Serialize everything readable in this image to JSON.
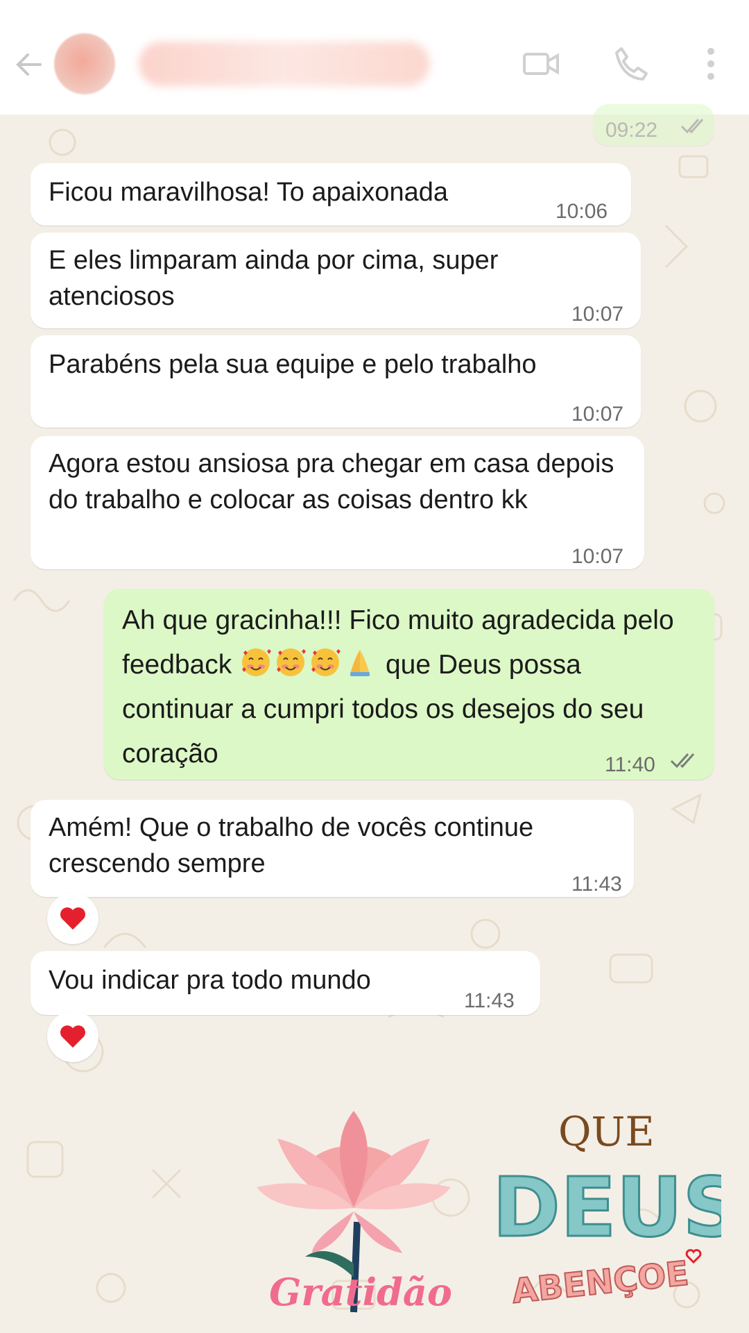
{
  "messages": [
    {
      "text": "",
      "time": "09:22",
      "direction": "out"
    },
    {
      "text": "Ficou maravilhosa! To apaixonada",
      "time": "10:06",
      "direction": "in"
    },
    {
      "text": "E eles limparam ainda por cima, super atenciosos",
      "time": "10:07",
      "direction": "in"
    },
    {
      "text": "Parabéns pela sua equipe e pelo trabalho",
      "time": "10:07",
      "direction": "in"
    },
    {
      "text": "Agora estou ansiosa pra chegar em casa depois do trabalho e colocar as coisas dentro kk",
      "time": "10:07",
      "direction": "in"
    },
    {
      "text_before_emoji": "Ah que gracinha!!! Fico muito agradecida pelo feedback",
      "emojis": [
        "smiling-face-with-hearts",
        "smiling-face-with-hearts",
        "smiling-face-with-hearts",
        "folded-hands"
      ],
      "text_after_emoji": "que Deus possa continuar a cumpri todos os desejos do seu coração",
      "time": "11:40",
      "direction": "out"
    },
    {
      "text": "Amém! Que o trabalho de vocês continue crescendo sempre",
      "time": "11:43",
      "direction": "in",
      "reaction": "red-heart"
    },
    {
      "text": "Vou indicar pra todo mundo",
      "time": "11:43",
      "direction": "in",
      "reaction": "red-heart"
    }
  ],
  "stickers": [
    {
      "name": "lotus-gratidao",
      "text": "Gratidão"
    },
    {
      "name": "que-deus-abencoe",
      "line1": "QUE",
      "line2": "DEUS",
      "line3": "ABENÇOE"
    }
  ],
  "colors": {
    "incoming": "#ffffff",
    "outgoing": "#dcf8c6",
    "wallpaper": "#f4efe6",
    "read_check": "#8a8a8a"
  }
}
